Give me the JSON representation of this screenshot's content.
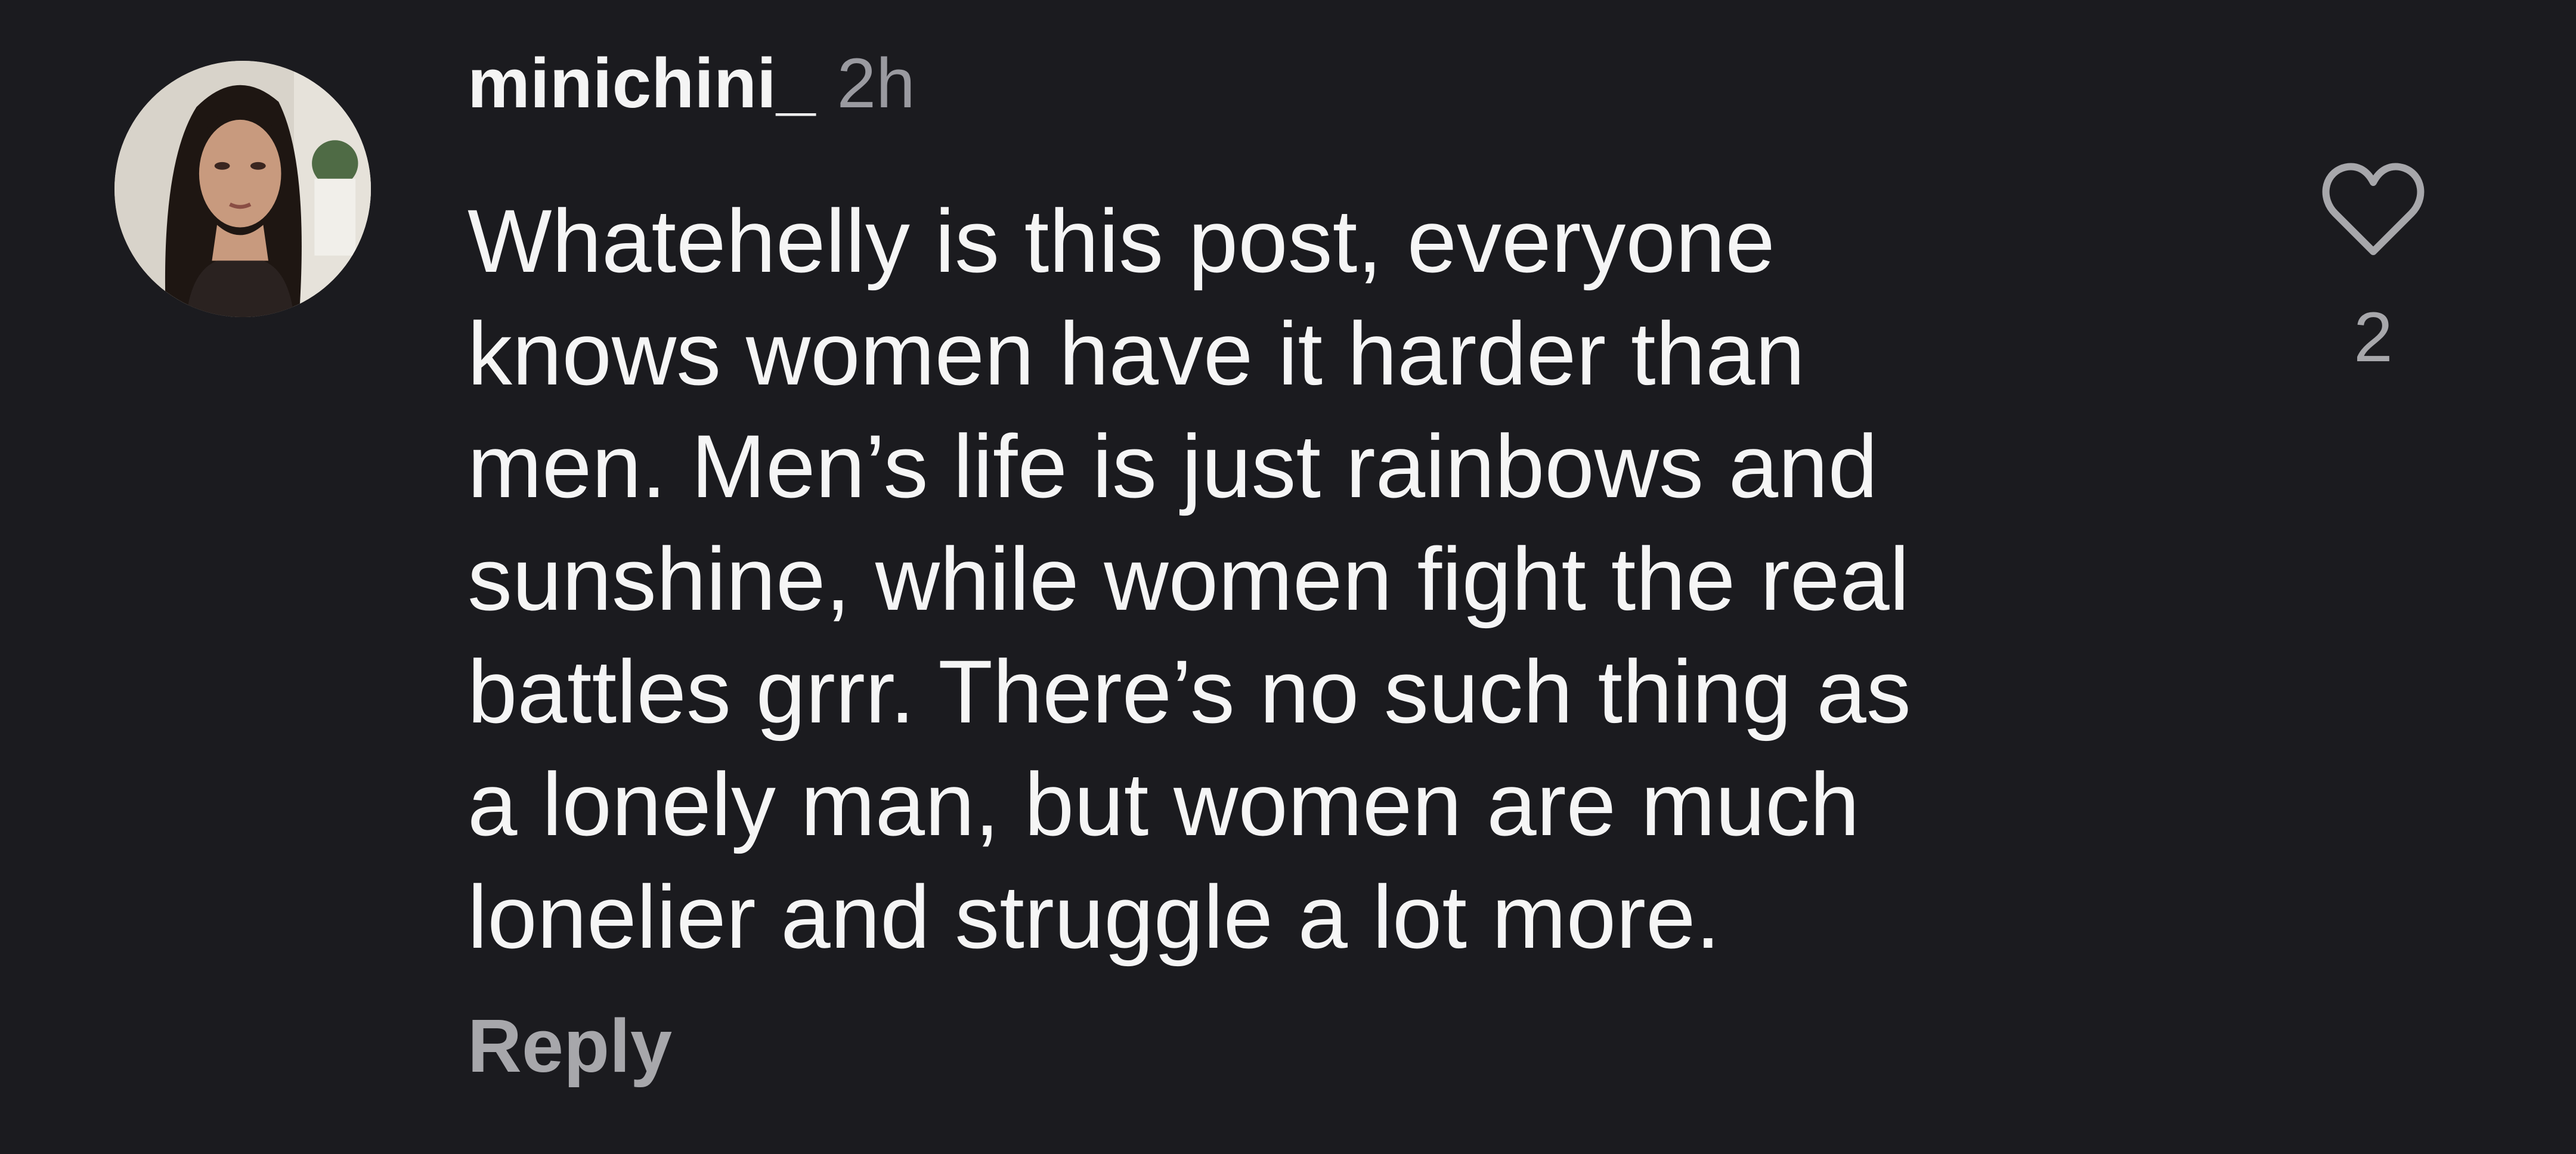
{
  "comment": {
    "username": "minichini_",
    "timestamp": "2h",
    "body_lines": [
      "Whatehelly is this post, everyone",
      "knows women have it harder than",
      "men. Men’s life is just rainbows and",
      "sunshine, while women fight the real",
      "battles grrr. There’s no such thing as",
      "a lonely man, but women are much",
      "lonelier and struggle a lot more."
    ],
    "reply_label": "Reply",
    "like_icon": "heart-outline-icon",
    "like_count": "2"
  },
  "colors": {
    "background": "#1b1b1f",
    "text_primary": "#f5f5f5",
    "text_secondary": "#a7a7ab"
  }
}
